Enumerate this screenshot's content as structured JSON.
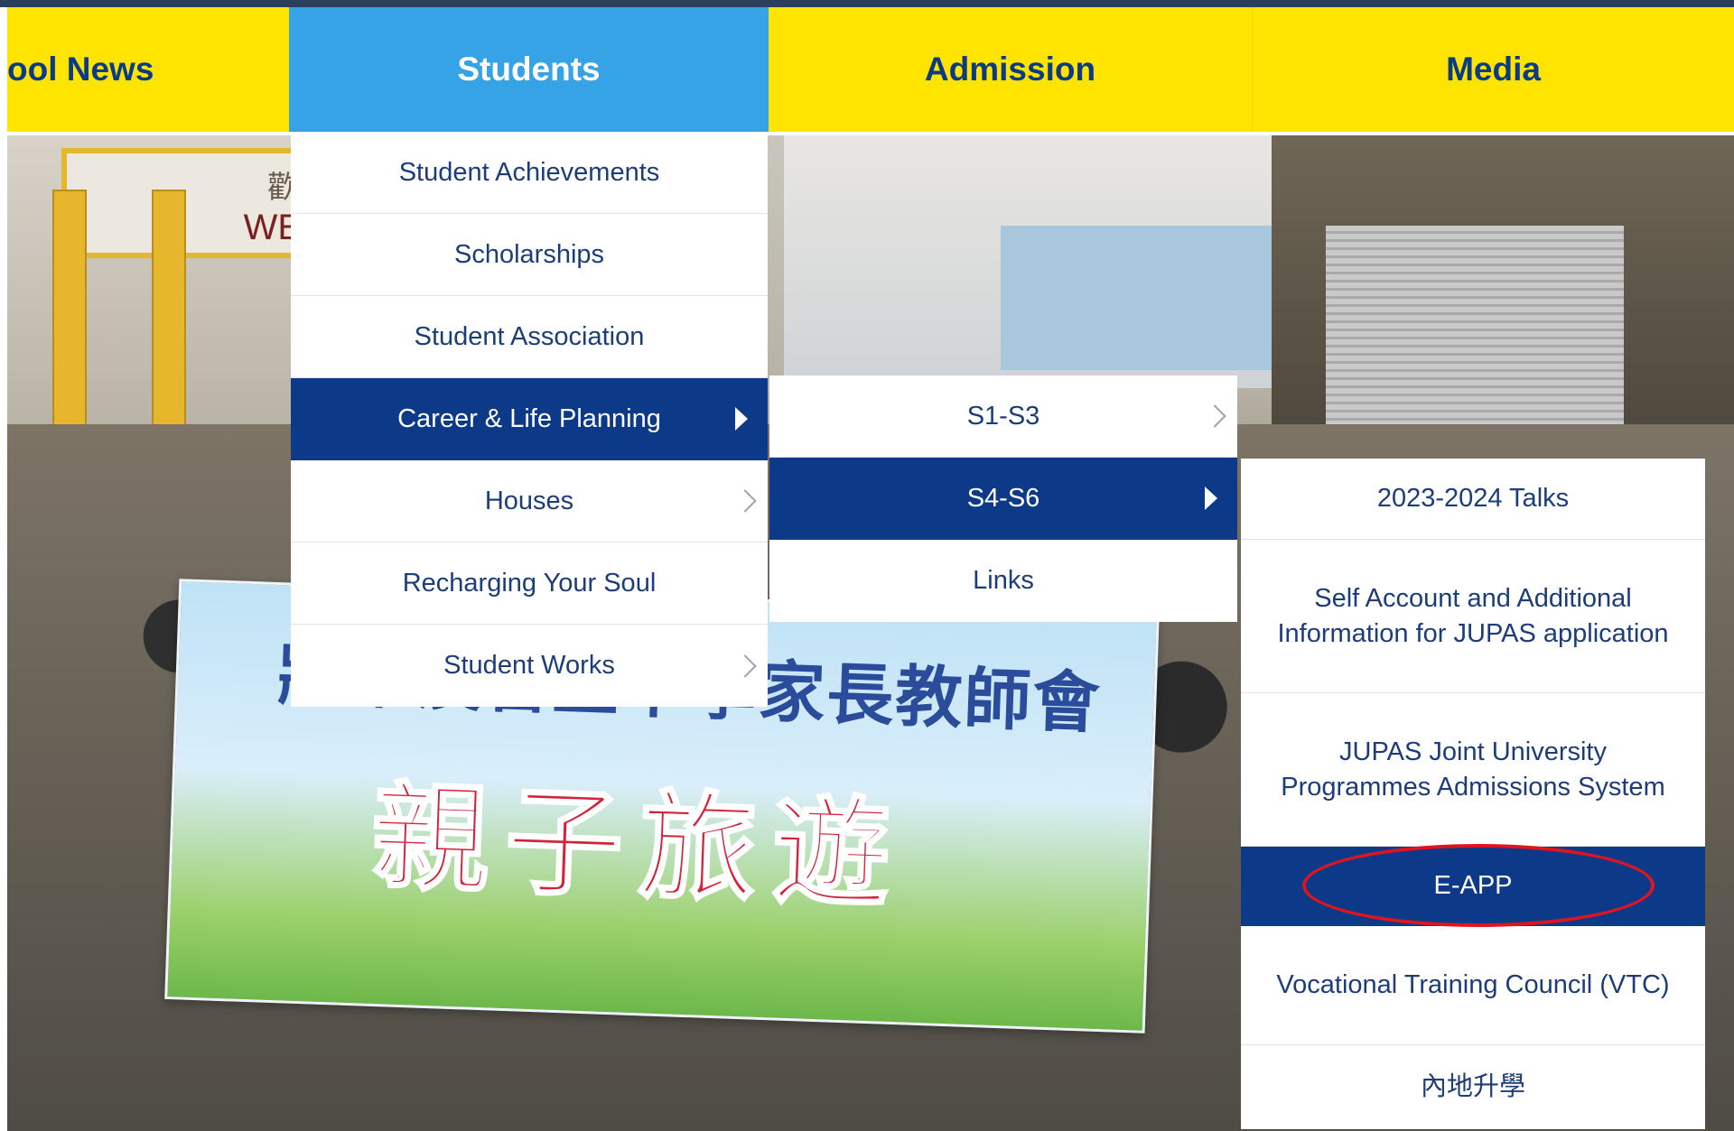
{
  "nav": {
    "items": [
      "ool News",
      "Students",
      "Admission",
      "Media"
    ]
  },
  "students_menu": {
    "items": [
      {
        "label": "Student Achievements"
      },
      {
        "label": "Scholarships"
      },
      {
        "label": "Student Association"
      },
      {
        "label": "Career & Life Planning"
      },
      {
        "label": "Houses"
      },
      {
        "label": "Recharging Your Soul"
      },
      {
        "label": "Student Works"
      }
    ]
  },
  "career_menu": {
    "items": [
      {
        "label": "S1-S3"
      },
      {
        "label": "S4-S6"
      },
      {
        "label": "Links"
      }
    ]
  },
  "s4s6_menu": {
    "items": [
      {
        "label": "2023-2024 Talks"
      },
      {
        "label": "Self Account and Additional Information for JUPAS application"
      },
      {
        "label": "JUPAS Joint University Programmes Admissions System"
      },
      {
        "label": "E-APP"
      },
      {
        "label": "Vocational Training Council (VTC)"
      },
      {
        "label": "內地升學"
      }
    ]
  },
  "photo": {
    "banner_line1": "將軍澳官立中學家長教師會",
    "banner_line2": "親子旅遊",
    "sign_text": "WE",
    "sign_char": "歡"
  },
  "colors": {
    "nav_bg": "#ffe400",
    "active_tab": "#36a3e6",
    "menu_active": "#0c3a88",
    "highlight_ring": "#e0141e"
  }
}
